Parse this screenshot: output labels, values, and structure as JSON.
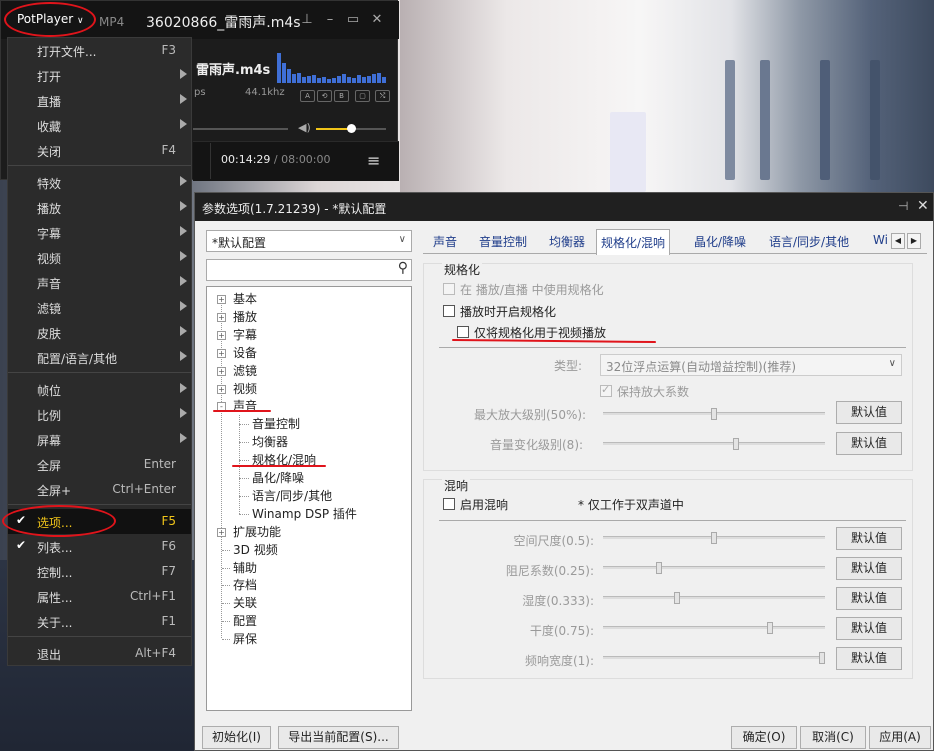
{
  "player": {
    "brand": "PotPlayer",
    "format": "MP4",
    "file_title": "36020866_雷雨声.m4s",
    "now_playing": "雷雨声.m4s",
    "bitrate_suffix": "ps",
    "sample_rate": "44.1khz",
    "time_current": "00:14:29",
    "time_sep": " / ",
    "time_total": "08:00:00",
    "volume_level": 0.5,
    "icons": [
      "pin-icon",
      "minimize-icon",
      "maximize-icon",
      "close-icon",
      "speaker-icon",
      "menu-icon"
    ]
  },
  "menu": {
    "items": [
      {
        "label": "打开文件...",
        "shortcut": "F3",
        "submenu": false
      },
      {
        "label": "打开",
        "shortcut": "",
        "submenu": true
      },
      {
        "label": "直播",
        "shortcut": "",
        "submenu": true
      },
      {
        "label": "收藏",
        "shortcut": "",
        "submenu": true
      },
      {
        "label": "关闭",
        "shortcut": "F4",
        "submenu": false
      },
      {
        "label": "特效",
        "shortcut": "",
        "submenu": true
      },
      {
        "label": "播放",
        "shortcut": "",
        "submenu": true
      },
      {
        "label": "字幕",
        "shortcut": "",
        "submenu": true
      },
      {
        "label": "视频",
        "shortcut": "",
        "submenu": true
      },
      {
        "label": "声音",
        "shortcut": "",
        "submenu": true
      },
      {
        "label": "滤镜",
        "shortcut": "",
        "submenu": true
      },
      {
        "label": "皮肤",
        "shortcut": "",
        "submenu": true
      },
      {
        "label": "配置/语言/其他",
        "shortcut": "",
        "submenu": true
      },
      {
        "label": "帧位",
        "shortcut": "",
        "submenu": true
      },
      {
        "label": "比例",
        "shortcut": "",
        "submenu": true
      },
      {
        "label": "屏幕",
        "shortcut": "",
        "submenu": true
      },
      {
        "label": "全屏",
        "shortcut": "Enter",
        "submenu": false
      },
      {
        "label": "全屏+",
        "shortcut": "Ctrl+Enter",
        "submenu": false
      },
      {
        "label": "选项...",
        "shortcut": "F5",
        "submenu": false,
        "checked": true,
        "selected": true
      },
      {
        "label": "列表...",
        "shortcut": "F6",
        "submenu": false,
        "checked": true
      },
      {
        "label": "控制...",
        "shortcut": "F7",
        "submenu": false
      },
      {
        "label": "属性...",
        "shortcut": "Ctrl+F1",
        "submenu": false
      },
      {
        "label": "关于...",
        "shortcut": "F1",
        "submenu": false
      },
      {
        "label": "退出",
        "shortcut": "Alt+F4",
        "submenu": false
      }
    ]
  },
  "dialog": {
    "title": "参数选项(1.7.21239) - *默认配置",
    "profile": "*默认配置",
    "search_placeholder": "",
    "tree": {
      "top": [
        "基本",
        "播放",
        "字幕",
        "设备",
        "滤镜",
        "视频",
        "声音"
      ],
      "sound_children": [
        "音量控制",
        "均衡器",
        "规格化/混响",
        "晶化/降噪",
        "语言/同步/其他",
        "Winamp DSP 插件"
      ],
      "bottom": [
        "扩展功能",
        "3D 视频",
        "辅助",
        "存档",
        "关联",
        "配置",
        "屏保"
      ]
    },
    "tabs": [
      "声音",
      "音量控制",
      "均衡器",
      "规格化/混响",
      "晶化/降噪",
      "语言/同步/其他",
      "Wi"
    ],
    "active_tab": "规格化/混响",
    "normalize": {
      "group_title": "规格化",
      "opt_live": "在 播放/直播 中使用规格化",
      "opt_on_play": "播放时开启规格化",
      "opt_video_only": "仅将规格化用于视频播放",
      "type_label": "类型:",
      "type_value": "32位浮点运算(自动增益控制)(推荐)",
      "keep_gain": "保持放大系数",
      "max_gain_label": "最大放大级别(50%):",
      "max_gain_value": 0.5,
      "vol_change_label": "音量变化级别(8):",
      "vol_change_value": 0.6,
      "default_label": "默认值"
    },
    "reverb": {
      "group_title": "混响",
      "enable_label": "启用混响",
      "note": "* 仅工作于双声道中",
      "rows": [
        {
          "label": "空间尺度(0.5):",
          "value": 0.5
        },
        {
          "label": "阻尼系数(0.25):",
          "value": 0.25
        },
        {
          "label": "湿度(0.333):",
          "value": 0.333
        },
        {
          "label": "干度(0.75):",
          "value": 0.75
        },
        {
          "label": "频响宽度(1):",
          "value": 1.0
        }
      ],
      "default_label": "默认值"
    },
    "footer": {
      "init_label": "初始化(I)",
      "export_label": "导出当前配置(S)...",
      "ok_label": "确定(O)",
      "cancel_label": "取消(C)",
      "apply_label": "应用(A)"
    }
  }
}
